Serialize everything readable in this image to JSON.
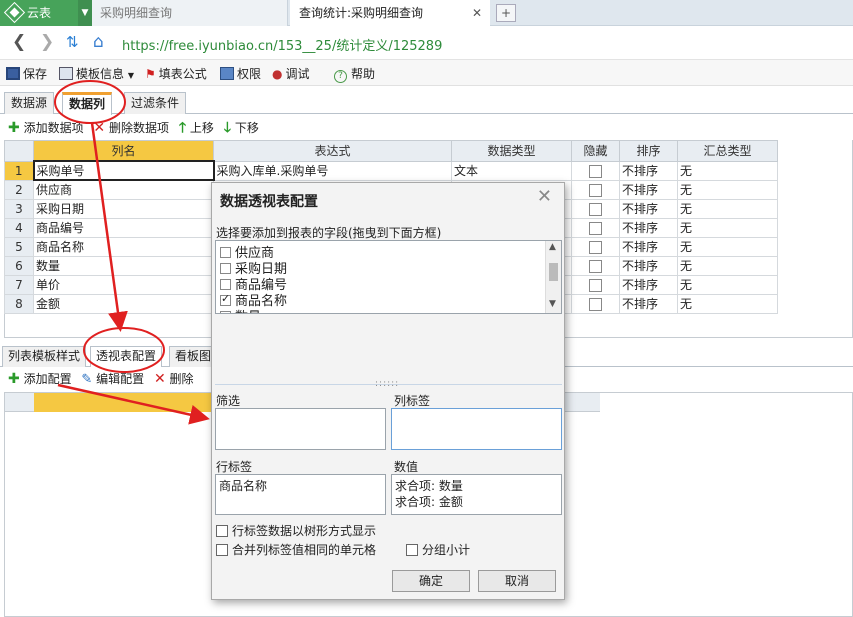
{
  "browser": {
    "app_name": "云表",
    "tabs": [
      "采购明细查询",
      "查询统计:采购明细查询"
    ],
    "url": "https://free.iyunbiao.cn/153__25/统计定义/125289"
  },
  "toolbar": {
    "save": "保存",
    "template_info": "模板信息",
    "fill_formula": "填表公式",
    "permission": "权限",
    "debug": "调试",
    "help": "帮助"
  },
  "main_tabs": [
    "数据源",
    "数据列",
    "过滤条件"
  ],
  "column_toolbar": {
    "add": "添加数据项",
    "delete": "删除数据项",
    "up": "上移",
    "down": "下移"
  },
  "grid": {
    "headers": [
      "列名",
      "表达式",
      "数据类型",
      "隐藏",
      "排序",
      "汇总类型"
    ],
    "rows": [
      {
        "n": "1",
        "name": "采购单号",
        "expr": "采购入库单.采购单号",
        "type": "文本",
        "sort": "不排序",
        "agg": "无"
      },
      {
        "n": "2",
        "name": "供应商",
        "expr": "",
        "type": "",
        "sort": "不排序",
        "agg": "无"
      },
      {
        "n": "3",
        "name": "采购日期",
        "expr": "",
        "type": "",
        "sort": "不排序",
        "agg": "无"
      },
      {
        "n": "4",
        "name": "商品编号",
        "expr": "",
        "type": "",
        "sort": "不排序",
        "agg": "无"
      },
      {
        "n": "5",
        "name": "商品名称",
        "expr": "",
        "type": "",
        "sort": "不排序",
        "agg": "无"
      },
      {
        "n": "6",
        "name": "数量",
        "expr": "",
        "type": "",
        "sort": "不排序",
        "agg": "无"
      },
      {
        "n": "7",
        "name": "单价",
        "expr": "",
        "type": "",
        "sort": "不排序",
        "agg": "无"
      },
      {
        "n": "8",
        "name": "金额",
        "expr": "",
        "type": "",
        "sort": "不排序",
        "agg": "无"
      }
    ]
  },
  "lower_tabs": [
    "列表模板样式",
    "透视表配置",
    "看板图"
  ],
  "config_toolbar": {
    "add": "添加配置",
    "edit": "编辑配置",
    "delete": "删除"
  },
  "dialog": {
    "title": "数据透视表配置",
    "field_prompt": "选择要添加到报表的字段(拖曳到下面方框)",
    "fields": [
      {
        "label": "供应商",
        "checked": false
      },
      {
        "label": "采购日期",
        "checked": false
      },
      {
        "label": "商品编号",
        "checked": false
      },
      {
        "label": "商品名称",
        "checked": true
      },
      {
        "label": "数量",
        "checked": false
      }
    ],
    "filter_label": "筛选",
    "column_label": "列标签",
    "row_label": "行标签",
    "value_label": "数值",
    "row_items": [
      "商品名称"
    ],
    "value_items": [
      "求合项: 数量",
      "求合项: 金额"
    ],
    "opt_tree": "行标签数据以树形方式显示",
    "opt_merge": "合并列标签值相同的单元格",
    "opt_subtotal": "分组小计",
    "ok": "确定",
    "cancel": "取消"
  },
  "colors": {
    "app_green": "#47a35a",
    "selected_header": "#f5c842",
    "annotation_red": "#e02020"
  }
}
